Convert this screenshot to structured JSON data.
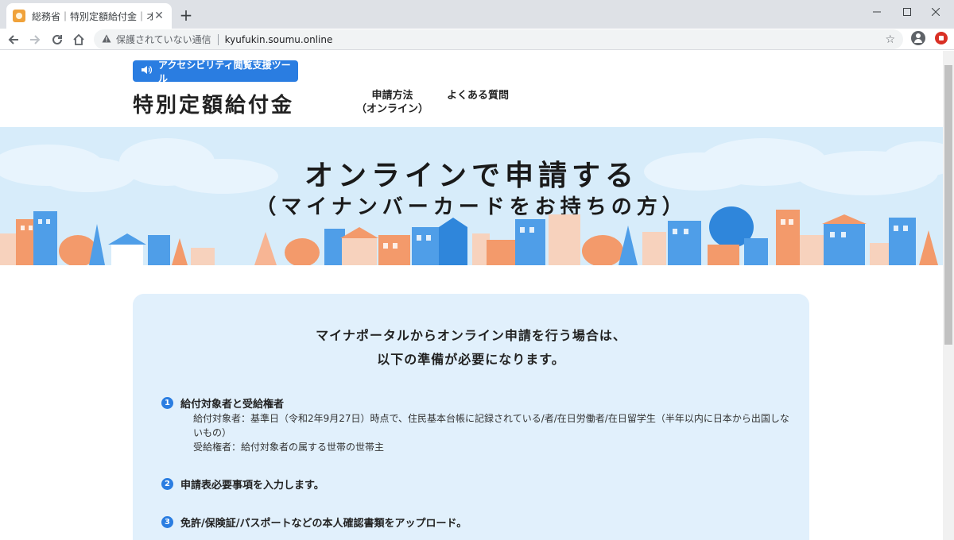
{
  "browser": {
    "tab_title": "総務省｜特別定額給付金｜オンライ",
    "new_tab_label": "+",
    "security_label": "保護されていない通信",
    "url": "kyufukin.soumu.online",
    "icons": [
      "back-arrow-icon",
      "forward-arrow-icon",
      "reload-icon",
      "home-icon",
      "warning-icon",
      "star-icon",
      "profile-icon",
      "extension-icon"
    ]
  },
  "header": {
    "accessibility_button": "アクセシビリティ閲覧支援ツール",
    "site_title": "特別定額給付金",
    "nav": {
      "online_line1": "申請方法",
      "online_line2": "（オンライン）",
      "faq": "よくある質問"
    }
  },
  "hero": {
    "title": "オンラインで申請する",
    "subtitle": "（マイナンバーカードをお持ちの方）"
  },
  "card": {
    "lead_line1": "マイナポータルからオンライン申請を行う場合は、",
    "lead_line2": "以下の準備が必要になります。",
    "steps": [
      {
        "number": "1",
        "heading": "給付対象者と受給権者",
        "lines": [
          "給付対象者：基準日（令和2年9月27日）時点で、住民基本台帳に記録されている/者/在日労働者/在日留学生（半年以内に日本から出国しないもの）",
          "受給権者：給付対象者の属する世帯の世帯主"
        ]
      },
      {
        "number": "2",
        "heading": "申請表必要事項を入力します。"
      },
      {
        "number": "3",
        "heading": "免許/保険証/パスポートなどの本人確認書類をアップロード。"
      }
    ]
  },
  "colors": {
    "accent_blue": "#2a7de1",
    "hero_bg": "#d7ecfa",
    "card_bg": "#e1f0fc",
    "building_orange": "#f39a6b",
    "building_blue": "#4f9ee8"
  }
}
